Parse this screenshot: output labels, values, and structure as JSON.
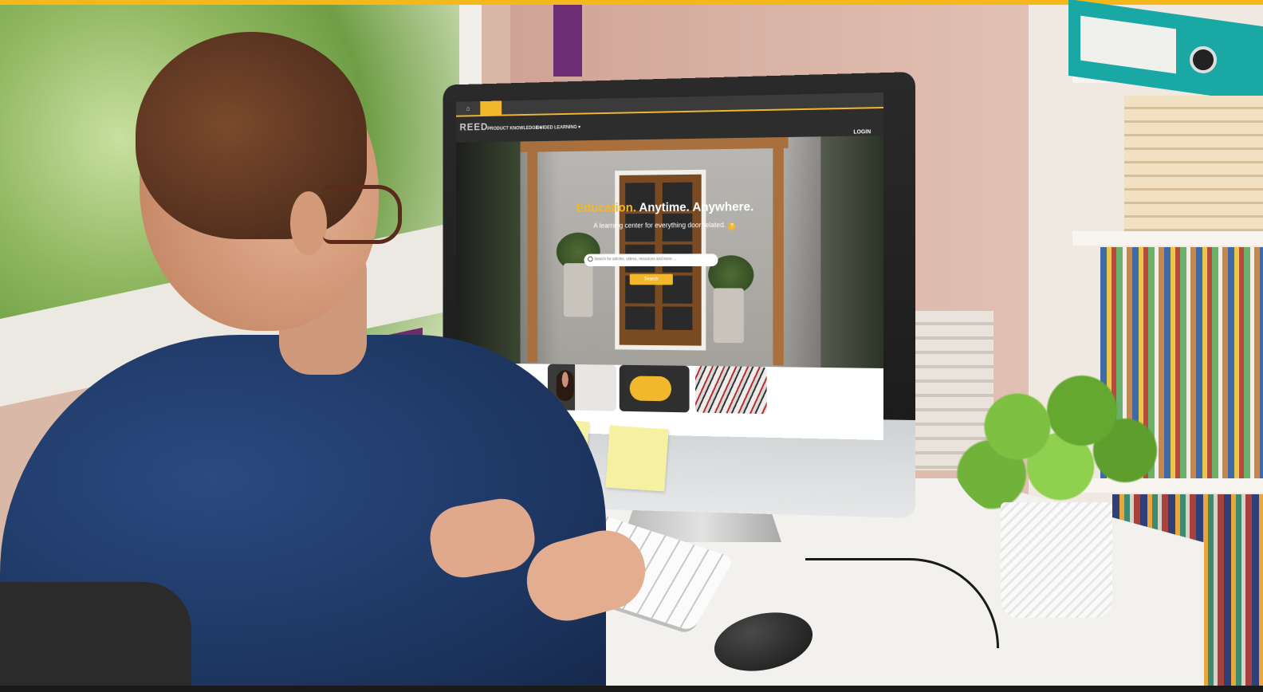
{
  "site": {
    "logo": "REED",
    "home_icon": "⌂",
    "nav": {
      "product_knowledge": "PRODUCT KNOWLEDGE ▾",
      "guided_learning": "GUIDED LEARNING ▾",
      "login": "LOGIN"
    },
    "hero": {
      "headline_accent": "Education.",
      "headline_rest": " Anytime. Anywhere.",
      "subhead": "A learning center for everything door related.",
      "help_icon": "?",
      "search_placeholder": "Search for articles, videos, resources and more ...",
      "search_button": "Search"
    }
  },
  "colors": {
    "accent": "#f1b82c",
    "frame_bar": "#f5b81a"
  }
}
